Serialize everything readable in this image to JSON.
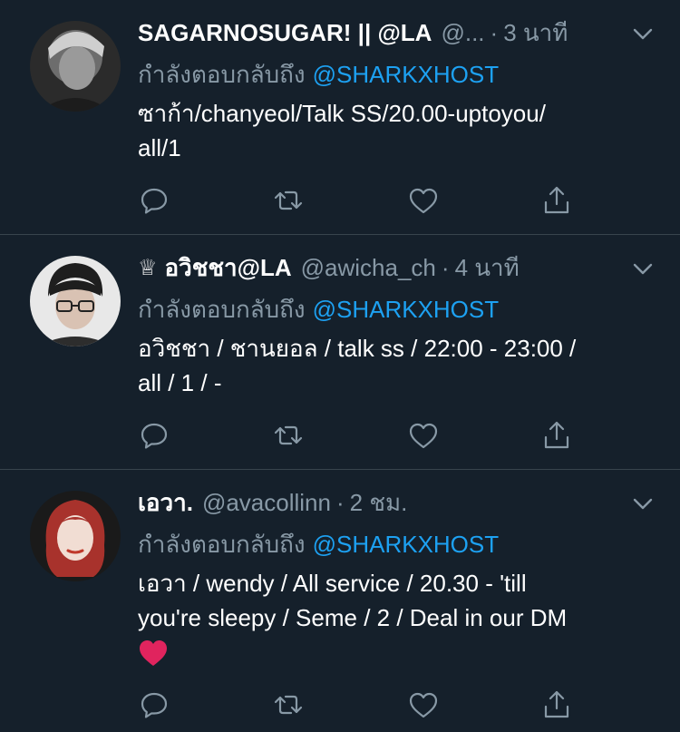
{
  "colors": {
    "background": "#15202b",
    "muted": "#8899a6",
    "link": "#1da1f2",
    "divider": "#38444d",
    "heart": "#e0245e"
  },
  "tweets": [
    {
      "display_name": "SAGARNOSUGAR! || @LA",
      "handle": "@...",
      "separator": "·",
      "time": "3 นาที",
      "reply_prefix": "กำลังตอบกลับถึง",
      "reply_mention": "@SHARKXHOST",
      "text_line1": "ซาก้า/chanyeol/Talk SS/20.00-uptoyou/",
      "text_line2": "all/1",
      "avatar": "avatar-grayscale-portrait"
    },
    {
      "crown": "♕",
      "display_name": "อวิชชา@LA",
      "handle": "@awicha_ch",
      "separator": "·",
      "time": "4 นาที",
      "reply_prefix": "กำลังตอบกลับถึง",
      "reply_mention": "@SHARKXHOST",
      "text_line1": "อวิชชา / ชานยอล / talk ss / 22:00 - 23:00 /",
      "text_line2": "all / 1 / -",
      "avatar": "avatar-glasses-portrait"
    },
    {
      "display_name": "เอวา.",
      "handle": "@avacollinn",
      "separator": "·",
      "time": "2 ชม.",
      "reply_prefix": "กำลังตอบกลับถึง",
      "reply_mention": "@SHARKXHOST",
      "text_line1": "เอวา / wendy / All service / 20.30 - 'till",
      "text_line2": "you're sleepy / Seme / 2 / Deal in our DM",
      "emoji": "❤️",
      "avatar": "avatar-redhair-portrait"
    }
  ],
  "icons": [
    "reply-icon",
    "retweet-icon",
    "like-icon",
    "share-icon",
    "chevron-down-icon"
  ]
}
